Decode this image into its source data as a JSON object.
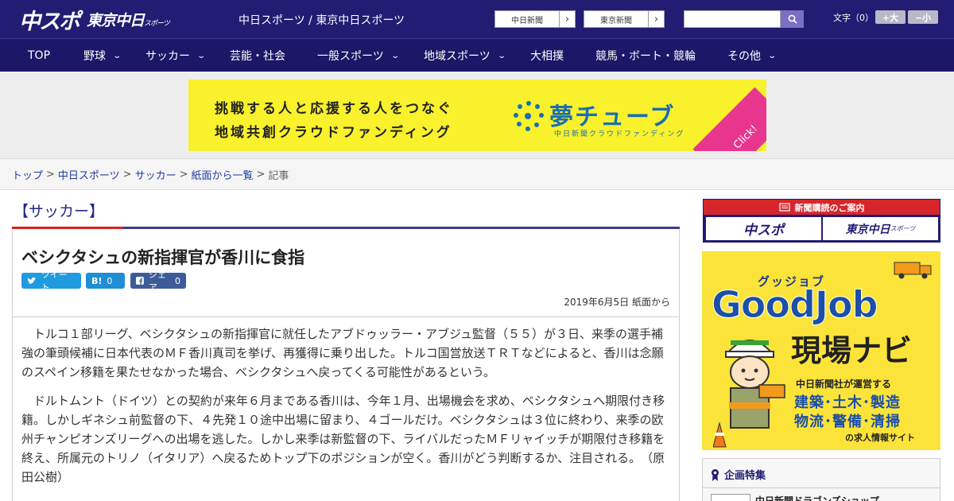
{
  "header": {
    "logo_main": "中スポ",
    "logo_sub": "東京中日",
    "logo_sub_small": "スポーツ",
    "site_title": "中日スポーツ / 東京中日スポーツ",
    "paper_links": [
      "中日新聞",
      "東京新聞"
    ],
    "search": {
      "value": "",
      "placeholder": ""
    },
    "font_size_label": "文字（0）",
    "font_larger": "+大",
    "font_smaller": "−小"
  },
  "nav": {
    "items": [
      {
        "label": "TOP",
        "dropdown": false
      },
      {
        "label": "野球",
        "dropdown": true
      },
      {
        "label": "サッカー",
        "dropdown": true
      },
      {
        "label": "芸能・社会",
        "dropdown": false
      },
      {
        "label": "一般スポーツ",
        "dropdown": true
      },
      {
        "label": "地域スポーツ",
        "dropdown": true
      },
      {
        "label": "大相撲",
        "dropdown": false
      },
      {
        "label": "競馬・ボート・競輪",
        "dropdown": false
      },
      {
        "label": "その他",
        "dropdown": true
      }
    ]
  },
  "banner": {
    "line1": "挑戦する人と応援する人をつなぐ",
    "line2": "地域共創クラウドファンディング",
    "brand": "夢チューブ",
    "brand_sub": "中日新聞クラウドファンディング",
    "click": "Click!"
  },
  "breadcrumb": {
    "links": [
      "トップ",
      "中日スポーツ",
      "サッカー",
      "紙面から一覧"
    ],
    "current": "記事",
    "separator": ">"
  },
  "article": {
    "section": "【サッカー】",
    "title": "ベシクタシュの新指揮官が香川に食指",
    "share": {
      "tweet": "ツイート",
      "hatena": "B!",
      "hatena_count": "0",
      "facebook": "シェア",
      "facebook_count": "0"
    },
    "date": "2019年6月5日 紙面から",
    "paragraphs": [
      "トルコ１部リーグ、ベシクタシュの新指揮官に就任したアブドゥッラー・アブジュ監督（５５）が３日、来季の選手補強の筆頭候補に日本代表のＭＦ香川真司を挙げ、再獲得に乗り出した。トルコ国営放送ＴＲＴなどによると、香川は念願のスペイン移籍を果たせなかった場合、ベシクタシュへ戻ってくる可能性があるという。",
      "ドルトムント（ドイツ）との契約が来年６月まである香川は、今年１月、出場機会を求め、ベシクタシュへ期限付き移籍。しかしギネシュ前監督の下、４先発１０途中出場に留まり、４ゴールだけ。ベシクタシュは３位に終わり、来季の欧州チャンピオンズリーグへの出場を逃した。しかし来季は新監督の下、ライバルだったＭＦリャイッチが期限付き移籍を終え、所属元のトリノ（イタリア）へ戻るためトップ下のポジションが空く。香川がどう判断するか、注目される。　（原田公樹）"
    ]
  },
  "sidebar": {
    "subscription": {
      "heading": "新聞購読のご案内",
      "tiles": [
        "中スポ",
        "東京中日"
      ],
      "tile_small": "スポーツ"
    },
    "goodjob": {
      "kana": "グッジョブ",
      "title": "GoodJob",
      "subtitle": "現場ナビ",
      "operator": "中日新聞社が運営する",
      "categories1": "建築･土木･製造",
      "categories2": "物流･警備･清掃",
      "site": "の求人情報サイト"
    },
    "tokushu": {
      "heading": "企画特集",
      "item": "中日新聞ドラゴンズショップ"
    }
  },
  "colors": {
    "header_bg": "#221c73",
    "nav_bg": "#1c1767",
    "accent_red": "#d92020",
    "banner_yellow": "#f8f12c",
    "link_blue": "#1f3aa0"
  }
}
